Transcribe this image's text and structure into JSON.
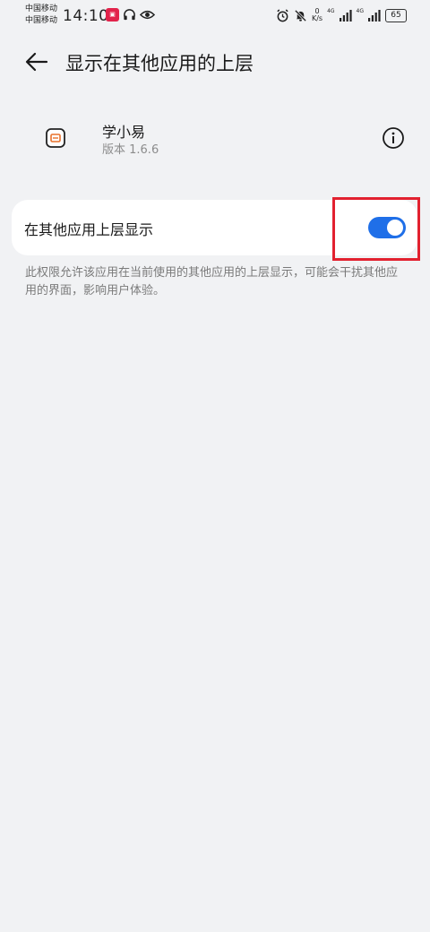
{
  "status_bar": {
    "carrier_1": "中国移动",
    "carrier_2": "中国移动",
    "time": "14:10",
    "net_speed_value": "0",
    "net_speed_unit": "K/s",
    "signal_1_label": "4G",
    "signal_2_label": "4G",
    "battery": "65"
  },
  "header": {
    "title": "显示在其他应用的上层"
  },
  "app": {
    "name": "学小易",
    "version": "版本 1.6.6"
  },
  "setting": {
    "label": "在其他应用上层显示",
    "enabled": true,
    "accent_color": "#1f6fe8"
  },
  "description": "此权限允许该应用在当前使用的其他应用的上层显示，可能会干扰其他应用的界面，影响用户体验。",
  "annotation": {
    "highlight_color": "#e2212f"
  }
}
